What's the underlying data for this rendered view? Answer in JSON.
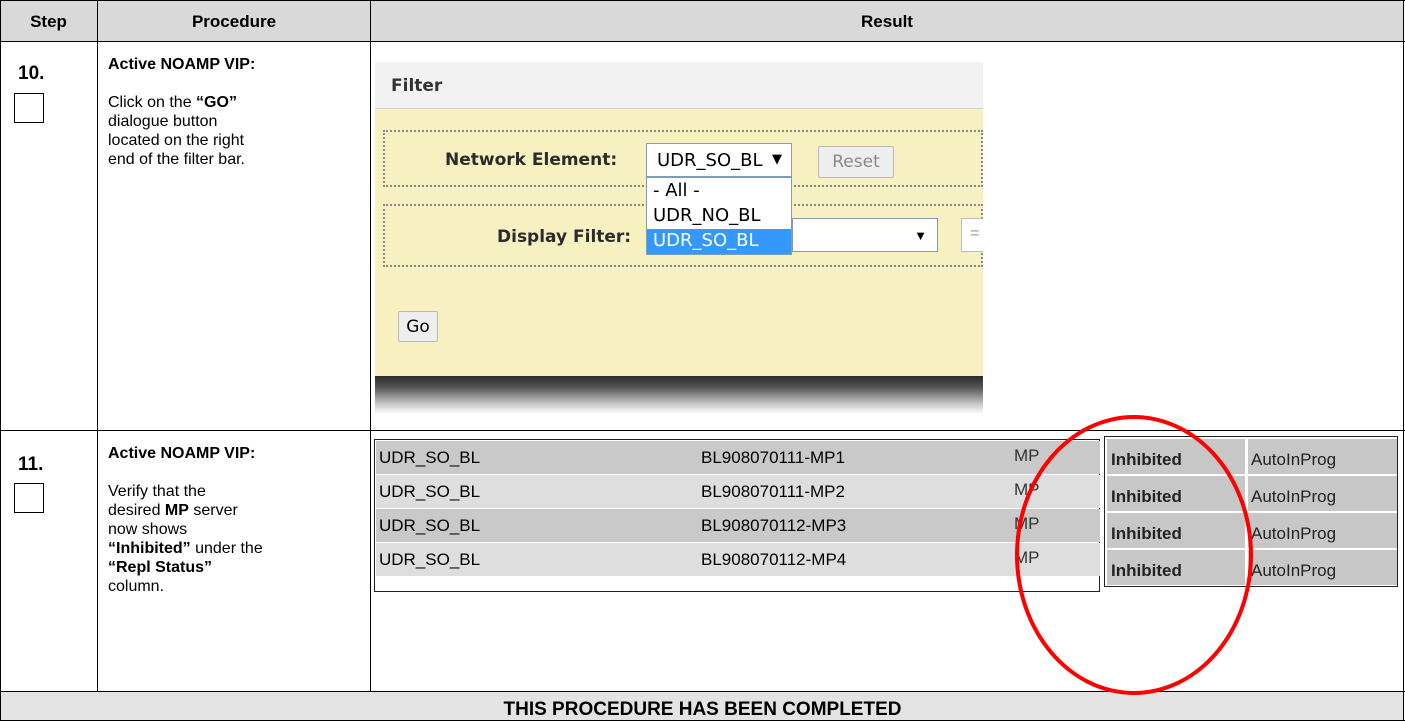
{
  "header": {
    "step": "Step",
    "procedure": "Procedure",
    "result": "Result"
  },
  "steps": [
    {
      "number": "10.",
      "title": "Active NOAMP VIP:",
      "text_lines": [
        "Click on the",
        "dialogue button",
        "located on the right",
        "end of the filter bar."
      ],
      "bold_inline": "“GO”"
    },
    {
      "number": "11.",
      "title": "Active NOAMP VIP:",
      "line1": "Verify that the",
      "line2a": "desired ",
      "line2b": "MP",
      "line2c": " server",
      "line3": "now shows",
      "line4a": "“Inhibited”",
      "line4b": " under the",
      "line5": "“Repl Status”",
      "line6": "column."
    }
  ],
  "filter": {
    "title": "Filter",
    "network_element_label": "Network Element:",
    "network_element_value": "UDR_SO_BL",
    "reset_label": "Reset",
    "display_filter_label": "Display Filter:",
    "dropdown_options": [
      "- All -",
      "UDR_NO_BL",
      "UDR_SO_BL"
    ],
    "dropdown_selected_index": 2,
    "go_label": "Go",
    "partial_operator": "="
  },
  "servers": [
    {
      "ne": "UDR_SO_BL",
      "server": "BL908070111-MP1",
      "role": "MP",
      "repl_status": "Inhibited",
      "ha": "AutoInProg"
    },
    {
      "ne": "UDR_SO_BL",
      "server": "BL908070111-MP2",
      "role": "MP",
      "repl_status": "Inhibited",
      "ha": "AutoInProg"
    },
    {
      "ne": "UDR_SO_BL",
      "server": "BL908070112-MP3",
      "role": "MP",
      "repl_status": "Inhibited",
      "ha": "AutoInProg"
    },
    {
      "ne": "UDR_SO_BL",
      "server": "BL908070112-MP4",
      "role": "MP",
      "repl_status": "Inhibited",
      "ha": "AutoInProg"
    }
  ],
  "footer": "THIS PROCEDURE HAS BEEN COMPLETED",
  "colors": {
    "header_bg": "#d9d9d9",
    "filter_bg": "#f7f1c2",
    "highlight": "#3399ff",
    "annotation_circle": "#ff0000"
  }
}
